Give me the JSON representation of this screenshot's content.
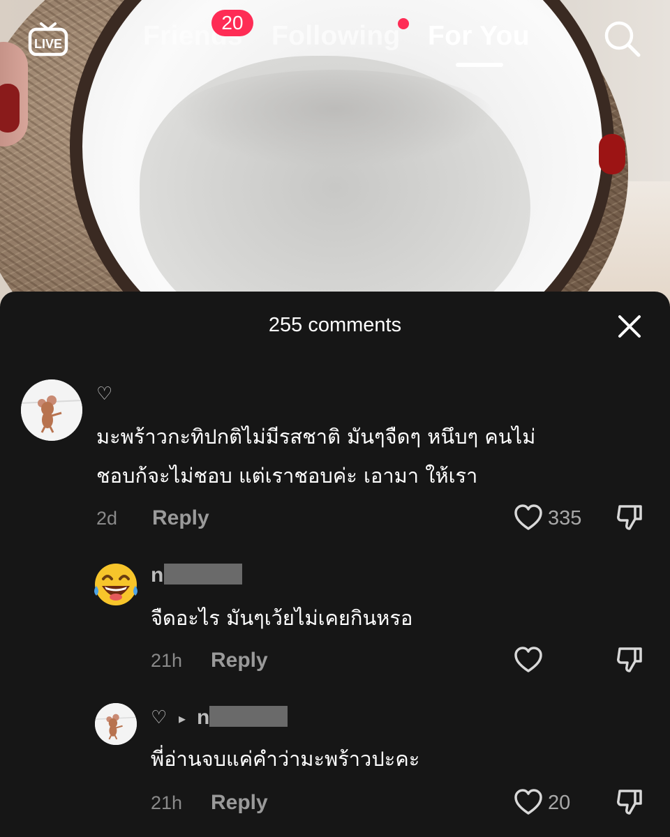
{
  "top_nav": {
    "live_label": "LIVE",
    "tabs": [
      {
        "label": "Friends",
        "badge": "20"
      },
      {
        "label": "Following"
      },
      {
        "label": "For You"
      }
    ],
    "active_tab": "For You"
  },
  "comments_panel": {
    "title": "255 comments",
    "comments": [
      {
        "text_line1": "มะพร้าวกะทิปกติไม่มีรสชาติ มันๆจืดๆ หนึบๆ คนไม่",
        "text_line2": "ชอบก้จะไม่ชอบ แต่เราชอบค่ะ เอามา ให้เรา",
        "time": "2d",
        "reply_label": "Reply",
        "like_count": "335",
        "small_heart": "♡"
      },
      {
        "author_initial": "n",
        "text": "จืดอะไร มันๆเว้ยไม่เคยกินหรอ",
        "time": "21h",
        "reply_label": "Reply",
        "like_count": ""
      },
      {
        "author_initial": "n",
        "small_heart": "♡",
        "reply_arrow": "▸",
        "text": "พี่อ่านจบแค่คำว่ามะพร้าวปะคะ",
        "time": "21h",
        "reply_label": "Reply",
        "like_count": "20"
      }
    ]
  },
  "colors": {
    "accent": "#fe2c55",
    "panel_bg": "#161616",
    "muted_text": "#8a8a8a"
  },
  "icons": [
    "live-tv-icon",
    "search-icon",
    "close-icon",
    "heart-icon",
    "dislike-icon",
    "laughing-emoji-icon"
  ]
}
